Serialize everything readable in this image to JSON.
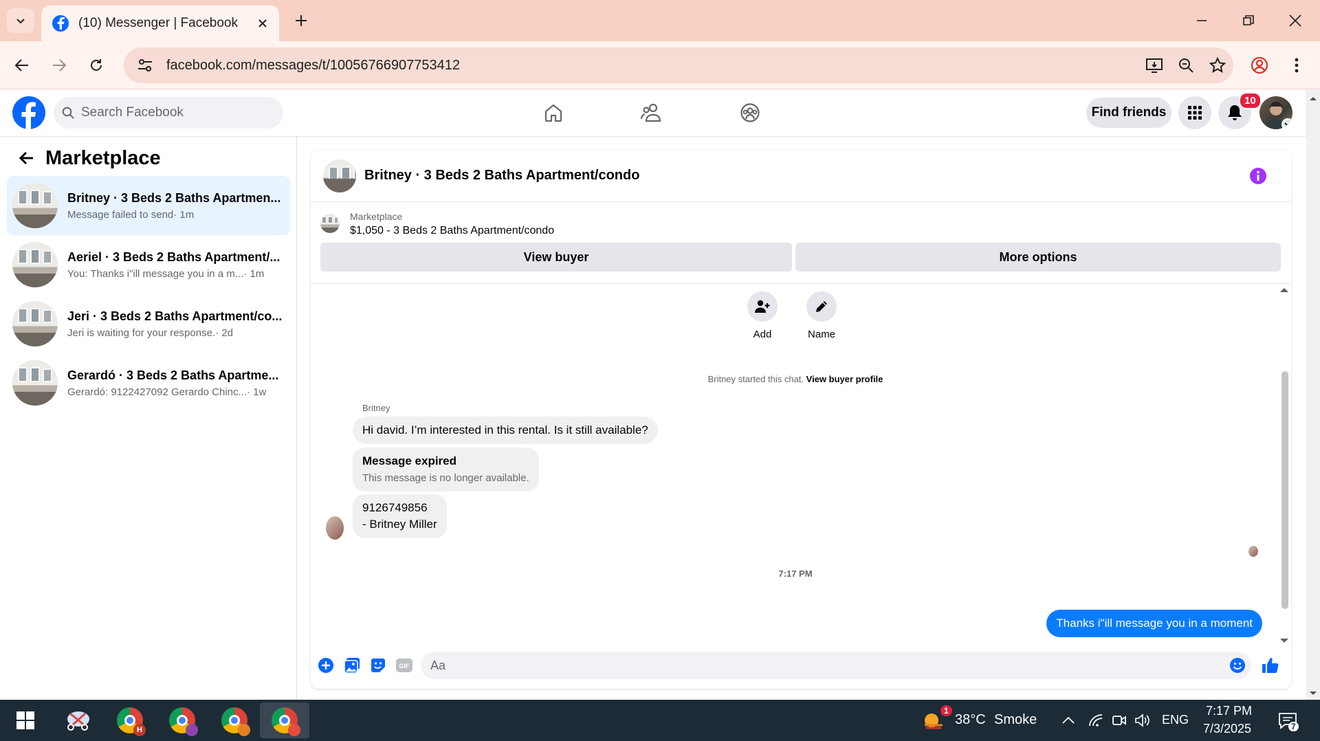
{
  "browser": {
    "tab_title": "(10) Messenger | Facebook",
    "url": "facebook.com/messages/t/10056766907753412"
  },
  "fb_header": {
    "search_placeholder": "Search Facebook",
    "find_friends": "Find friends",
    "notification_count": "10"
  },
  "sidebar": {
    "title": "Marketplace",
    "conversations": [
      {
        "name": "Britney · 3 Beds 2 Baths Apartmen...",
        "snippet": "Message failed to send",
        "time": "· 1m",
        "active": true
      },
      {
        "name": "Aeriel · 3 Beds 2 Baths Apartment/...",
        "snippet": "You: Thanks i\"ill message you in a m...",
        "time": "· 1m",
        "active": false
      },
      {
        "name": "Jeri · 3 Beds 2 Baths Apartment/co...",
        "snippet": "Jeri is waiting for your response.",
        "time": "· 2d",
        "active": false
      },
      {
        "name": "Gerardó · 3 Beds 2 Baths Apartme...",
        "snippet": "Gerardó: 9122427092 Gerardo Chinc...",
        "time": "· 1w",
        "active": false
      }
    ]
  },
  "chat": {
    "title": "Britney · 3 Beds 2 Baths Apartment/condo",
    "listing_label": "Marketplace",
    "listing_price": "$1,050 - 3 Beds 2 Baths Apartment/condo",
    "view_buyer": "View buyer",
    "more_options": "More options",
    "actions": {
      "add": "Add",
      "name": "Name"
    },
    "started_text": "Britney started this chat.",
    "started_link": "View buyer profile",
    "sender": "Britney",
    "msg1": "Hi david. I’m interested in this rental. Is it still available?",
    "expired_title": "Message expired",
    "expired_sub": "This message is no longer available.",
    "msg3_line1": "9126749856",
    "msg3_line2": "- Britney Miller",
    "timestamp": "7:17 PM",
    "my_msg": "Thanks i\"ill message you in a moment",
    "composer_placeholder": "Aa"
  },
  "taskbar": {
    "weather_temp": "38°C",
    "weather_desc": "Smoke",
    "weather_badge": "1",
    "lang": "ENG",
    "time": "7:17 PM",
    "date": "7/3/2025",
    "notif_count": "7"
  },
  "colors": {
    "fb_blue": "#0866ff",
    "msg_blue": "#0a7cff",
    "info_purple": "#a033ff",
    "tab_bg": "#f8d0c4"
  }
}
